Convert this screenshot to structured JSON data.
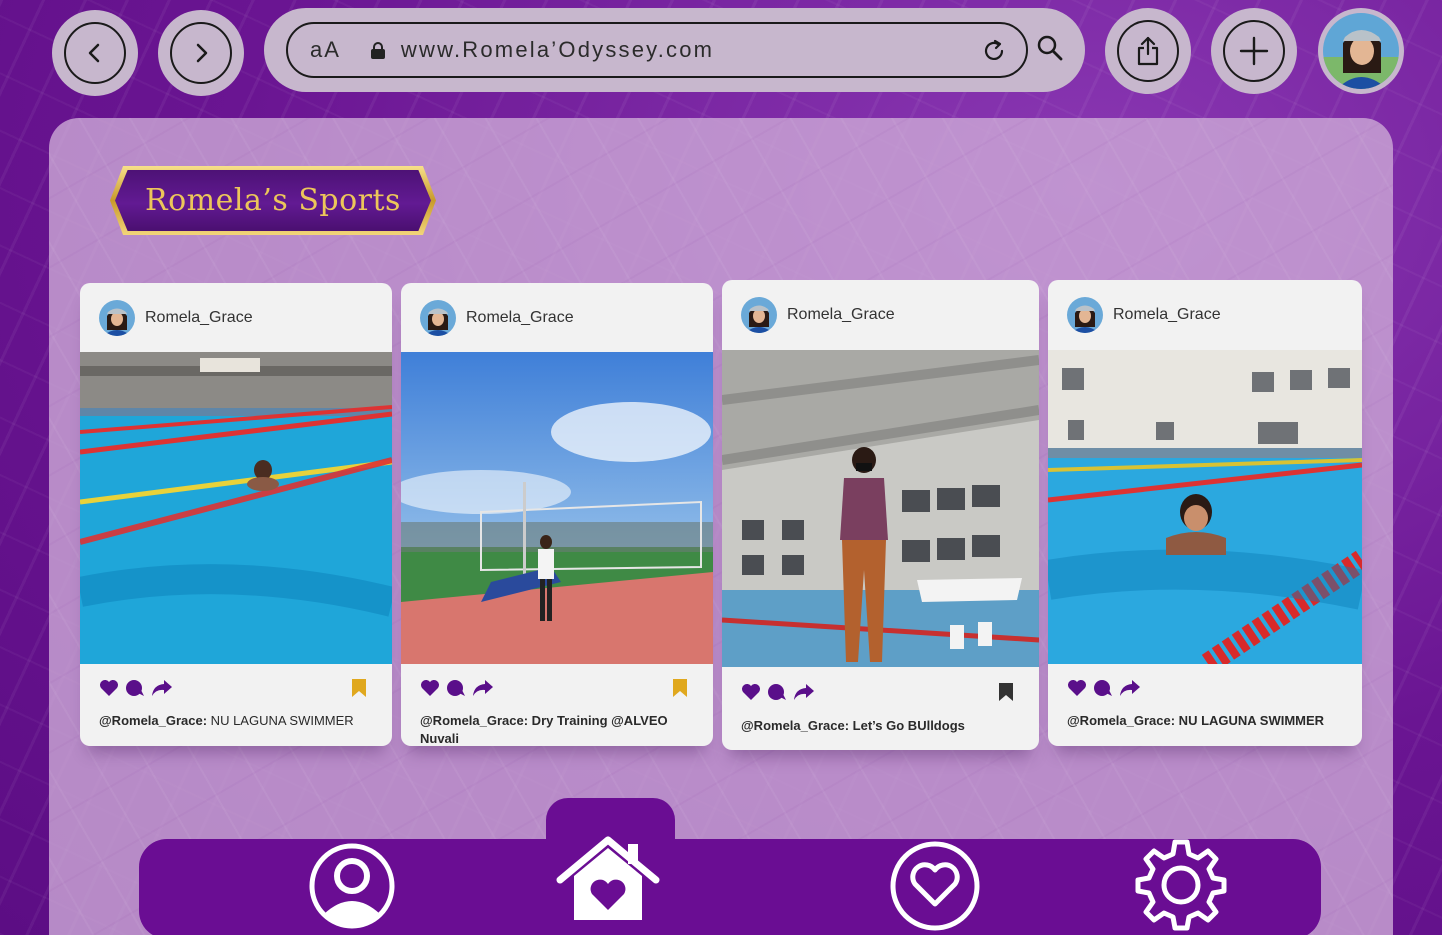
{
  "browser": {
    "text_size_label": "aA",
    "url": "www.Romela’Odyssey.com",
    "back_icon": "chevron-left-icon",
    "forward_icon": "chevron-right-icon",
    "share_icon": "share-icon",
    "add_icon": "plus-icon"
  },
  "page": {
    "title": "Romela’s Sports"
  },
  "posts": [
    {
      "username": "Romela_Grace",
      "handle": "@Romela_Grace:",
      "caption": " NU LAGUNA SWIMMER",
      "bookmark_color": "#e0a81e"
    },
    {
      "username": "Romela_Grace",
      "handle": "@Romela_Grace:",
      "caption": " Dry Training @ALVEO Nuvali",
      "bookmark_color": "#e0a81e"
    },
    {
      "username": "Romela_Grace",
      "handle": "@Romela_Grace:",
      "caption": " Let’s Go BUlldogs",
      "bookmark_color": "#333333"
    },
    {
      "username": "Romela_Grace",
      "handle": "@Romela_Grace:",
      "caption": " NU LAGUNA SWIMMER",
      "bookmark_color": null
    }
  ],
  "nav": {
    "items": [
      "profile-icon",
      "home-heart-icon",
      "heart-icon",
      "settings-gear-icon"
    ]
  },
  "colors": {
    "brand_purple": "#6a0d93",
    "action_purple": "#5a0f8a",
    "gold": "#ecc65a"
  }
}
